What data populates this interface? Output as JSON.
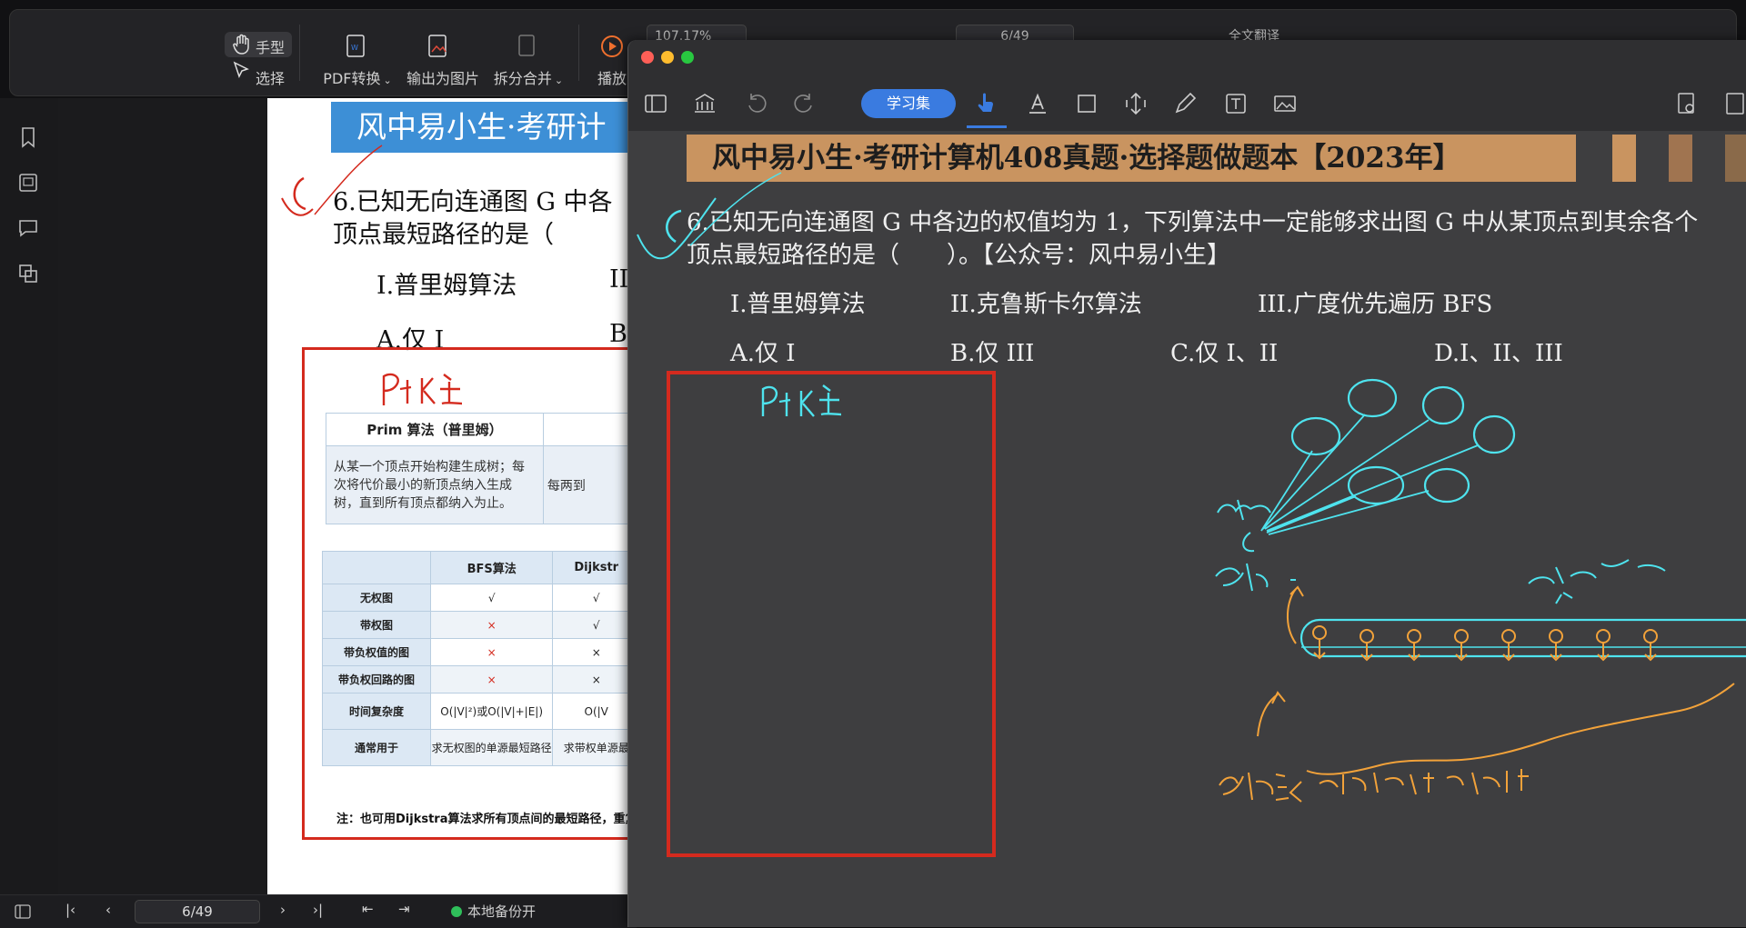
{
  "back_toolbar": {
    "hand_tool": "手型",
    "select_tool": "选择",
    "pdf_convert": "PDF转换",
    "export_image": "输出为图片",
    "split_merge": "拆分合并",
    "play": "播放",
    "zoom": "107.17%",
    "page": "6/49",
    "translate": "全文翻译"
  },
  "back_status": {
    "page": "6/49",
    "backup": "本地备份开"
  },
  "back_page": {
    "banner": "风中易小生·考研计",
    "question_line1": "6.已知无向连通图 G 中各",
    "question_line2": "顶点最短路径的是（",
    "option_i": "I.普里姆算法",
    "option_ii_partial": "II",
    "answer_a": "A.仅 I",
    "answer_b_partial": "B",
    "prim_header": "Prim 算法（普里姆）",
    "prim_desc": "从某一个顶点开始构建生成树；每次将代价最小的新顶点纳入生成树，直到所有顶点都纳入为止。",
    "side_desc_partial": "每两到",
    "table": {
      "col_bfs": "BFS算法",
      "col_dijkstra": "Dijkstr",
      "rows": [
        {
          "label": "无权图",
          "bfs": "√",
          "dij": "√"
        },
        {
          "label": "带权图",
          "bfs": "×",
          "dij": "√"
        },
        {
          "label": "带负权值的图",
          "bfs": "×",
          "dij": "×"
        },
        {
          "label": "带负权回路的图",
          "bfs": "×",
          "dij": "×"
        },
        {
          "label": "时间复杂度",
          "bfs": "O(|V|²)或O(|V|+|E|)",
          "dij": "O(|V"
        },
        {
          "label": "通常用于",
          "bfs": "求无权图的单源最短路径",
          "dij": "求带权单源最"
        }
      ]
    },
    "note": "注：也可用Dijkstra算法求所有顶点间的最短路径，重复|V|"
  },
  "front_toolbar": {
    "study_set": "学习集"
  },
  "front_page": {
    "banner": "风中易小生·考研计算机408真题·选择题做题本【2023年】",
    "question_line1": "6.已知无向连通图 G 中各边的权值均为 1，下列算法中一定能够求出图 G 中从某顶点到其余各个",
    "question_line2": "顶点最短路径的是（　　）。【公众号：风中易小生】",
    "option_i": "I.普里姆算法",
    "option_ii": "II.克鲁斯卡尔算法",
    "option_iii": "III.广度优先遍历 BFS",
    "answer_a": "A.仅 I",
    "answer_b": "B.仅 III",
    "answer_c": "C.仅 I、II",
    "answer_d": "D.I、II、III"
  },
  "colors": {
    "accent": "#3a7be0",
    "annotation_red": "#d42a1e",
    "handwriting_cyan": "#4ee3ee",
    "handwriting_orange": "#f2a23a",
    "front_banner": "#c99460",
    "back_banner": "#3d8fd6"
  },
  "icons": [
    "hand-icon",
    "cursor-icon",
    "pdf-convert-icon",
    "image-export-icon",
    "split-icon",
    "play-icon",
    "bookmark-icon",
    "thumbnail-icon",
    "comment-icon",
    "copy-icon",
    "sidebar-icon",
    "library-icon",
    "undo-icon",
    "redo-icon",
    "pointer-icon",
    "text-highlight-icon",
    "crop-icon",
    "resize-icon",
    "pen-icon",
    "textbox-icon",
    "image-icon",
    "search-doc-icon"
  ]
}
